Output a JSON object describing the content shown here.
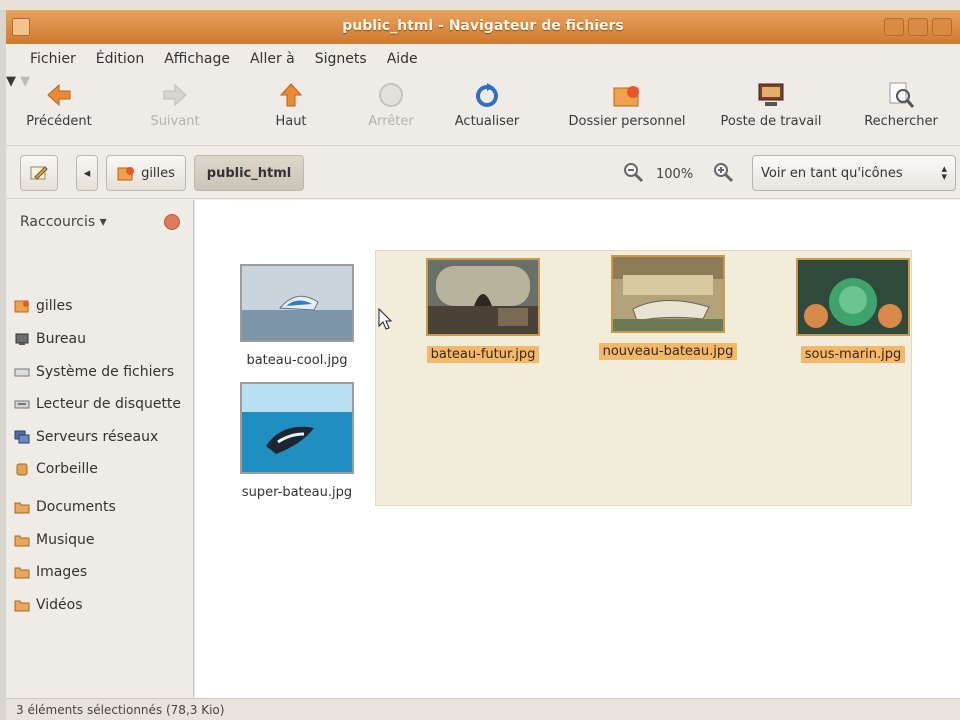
{
  "window": {
    "title": "public_html - Navigateur de fichiers"
  },
  "menubar": {
    "items": [
      "Fichier",
      "Édition",
      "Affichage",
      "Aller à",
      "Signets",
      "Aide"
    ]
  },
  "toolbar": {
    "back": "Précédent",
    "forward": "Suivant",
    "up": "Haut",
    "stop": "Arrêter",
    "reload": "Actualiser",
    "home": "Dossier personnel",
    "computer": "Poste de travail",
    "search": "Rechercher"
  },
  "location": {
    "path": [
      "gilles",
      "public_html"
    ],
    "zoom": "100%",
    "view_mode": "Voir en tant qu'icônes"
  },
  "sidebar": {
    "header": "Raccourcis",
    "items": [
      {
        "label": "gilles",
        "icon": "home-folder-icon"
      },
      {
        "label": "Bureau",
        "icon": "desktop-icon"
      },
      {
        "label": "Système de fichiers",
        "icon": "filesystem-icon"
      },
      {
        "label": "Lecteur de disquette",
        "icon": "floppy-icon"
      },
      {
        "label": "Serveurs réseaux",
        "icon": "network-icon"
      },
      {
        "label": "Corbeille",
        "icon": "trash-icon"
      },
      {
        "label": "Documents",
        "icon": "folder-icon"
      },
      {
        "label": "Musique",
        "icon": "folder-icon"
      },
      {
        "label": "Images",
        "icon": "folder-icon"
      },
      {
        "label": "Vidéos",
        "icon": "folder-icon"
      }
    ]
  },
  "files": [
    {
      "name": "bateau-cool.jpg",
      "selected": false
    },
    {
      "name": "bateau-futur.jpg",
      "selected": true
    },
    {
      "name": "nouveau-bateau.jpg",
      "selected": true
    },
    {
      "name": "sous-marin.jpg",
      "selected": true
    },
    {
      "name": "super-bateau.jpg",
      "selected": false
    }
  ],
  "statusbar": {
    "text": "3 éléments sélectionnés (78,3 Kio)"
  },
  "colors": {
    "titlebar": "#d98a3f",
    "selection": "#f3b869",
    "accent_orange": "#e8772a"
  }
}
